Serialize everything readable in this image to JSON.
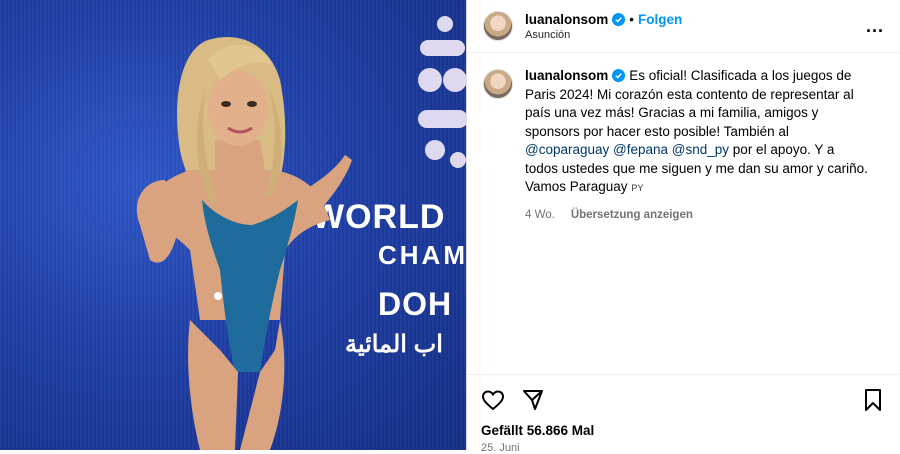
{
  "post": {
    "username": "luanalonsom",
    "follow_label": "Folgen",
    "separator": "•",
    "location": "Asunción",
    "more_label": "...",
    "caption_part1": "Es oficial! Clasificada a los juegos de Paris 2024! Mi corazón esta contento de representar al país una vez más! Gracias a mi familia, amigos y sponsors por hacer esto posible! También al ",
    "mention1": "@coparaguay",
    "mention2": "@fepana",
    "mention3": "@snd_py",
    "caption_part2": " por el apoyo. Y a todos ustedes que me siguen y me dan su amor y cariño. Vamos Paraguay ",
    "flag_text": "PY",
    "time_ago": "4 Wo.",
    "translate_label": "Übersetzung anzeigen",
    "likes": "Gefällt 56.866 Mal",
    "date": "25. Juni"
  },
  "media": {
    "text_line1": "WORLD",
    "text_line2": "CHAM",
    "text_line3": "DOH",
    "text_line4": "اب المائية"
  },
  "icons": {
    "verified": "verified-badge-icon",
    "like": "heart-icon",
    "share": "send-icon",
    "save": "bookmark-icon"
  },
  "colors": {
    "accent": "#0095f6",
    "verified": "#0095f6",
    "mention": "#00376b",
    "media_blue": "#1f3fa6"
  }
}
